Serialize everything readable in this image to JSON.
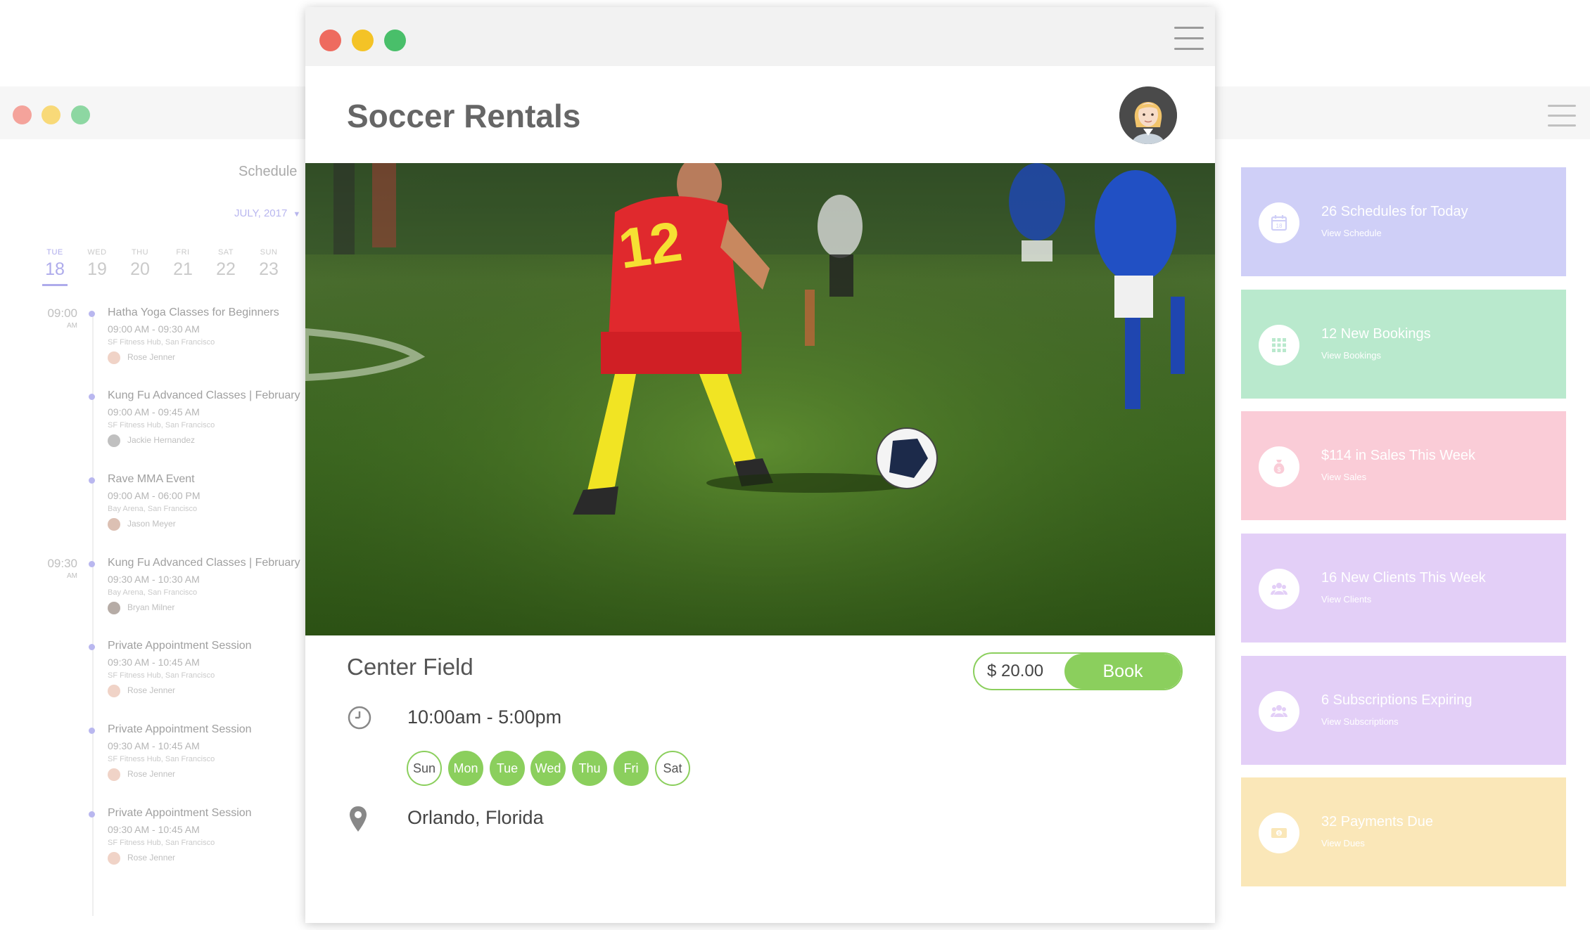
{
  "bg_window": {
    "schedule_title": "Schedule",
    "month": "JULY, 2017",
    "days": [
      {
        "name": "TUE",
        "num": "18"
      },
      {
        "name": "WED",
        "num": "19"
      },
      {
        "name": "THU",
        "num": "20"
      },
      {
        "name": "FRI",
        "num": "21"
      },
      {
        "name": "SAT",
        "num": "22"
      },
      {
        "name": "SUN",
        "num": "23"
      }
    ],
    "time_slots": [
      {
        "time": "09:00",
        "ampm": "AM"
      },
      {
        "time": "09:30",
        "ampm": "AM"
      }
    ],
    "events": [
      {
        "title": "Hatha Yoga Classes for Beginners",
        "time": "09:00 AM - 09:30 AM",
        "location": "SF Fitness Hub, San Francisco",
        "person": "Rose Jenner"
      },
      {
        "title": "Kung Fu Advanced Classes | February",
        "time": "09:00 AM - 09:45 AM",
        "location": "SF Fitness Hub, San Francisco",
        "person": "Jackie Hernandez"
      },
      {
        "title": "Rave MMA Event",
        "time": "09:00 AM - 06:00 PM",
        "location": "Bay Arena, San Francisco",
        "person": "Jason Meyer"
      },
      {
        "title": "Kung Fu Advanced Classes | February",
        "time": "09:30 AM - 10:30 AM",
        "location": "Bay Arena, San Francisco",
        "person": "Bryan Milner"
      },
      {
        "title": "Private Appointment Session",
        "time": "09:30 AM - 10:45 AM",
        "location": "SF Fitness Hub, San Francisco",
        "person": "Rose Jenner"
      },
      {
        "title": "Private Appointment Session",
        "time": "09:30 AM - 10:45 AM",
        "location": "SF Fitness Hub, San Francisco",
        "person": "Rose Jenner"
      },
      {
        "title": "Private Appointment Session",
        "time": "09:30 AM - 10:45 AM",
        "location": "SF Fitness Hub, San Francisco",
        "person": "Rose Jenner"
      }
    ],
    "cards": [
      {
        "title": "26 Schedules for Today",
        "sub": "View Schedule",
        "color": "#b3b2f3",
        "icon": "calendar-icon"
      },
      {
        "title": "12 New Bookings",
        "sub": "View Bookings",
        "color": "#8fddb0",
        "icon": "grid-icon"
      },
      {
        "title": "$114 in Sales This Week",
        "sub": "View Sales",
        "color": "#f7aec0",
        "icon": "money-bag-icon"
      },
      {
        "title": "16 New Clients This Week",
        "sub": "View Clients",
        "color": "#d2b3f3",
        "icon": "people-icon"
      },
      {
        "title": "6 Subscriptions Expiring",
        "sub": "View Subscriptions",
        "color": "#d2b3f3",
        "icon": "people-icon"
      },
      {
        "title": "32 Payments Due",
        "sub": "View Dues",
        "color": "#f7d98e",
        "icon": "cash-icon"
      }
    ]
  },
  "app": {
    "title": "Soccer Rentals",
    "field_name": "Center Field",
    "price": "$ 20.00",
    "book_label": "Book",
    "hours": "10:00am - 5:00pm",
    "days": [
      {
        "label": "Sun",
        "active": false
      },
      {
        "label": "Mon",
        "active": true
      },
      {
        "label": "Tue",
        "active": true
      },
      {
        "label": "Wed",
        "active": true
      },
      {
        "label": "Thu",
        "active": true
      },
      {
        "label": "Fri",
        "active": true
      },
      {
        "label": "Sat",
        "active": false
      }
    ],
    "location": "Orlando, Florida"
  },
  "colors": {
    "accent_green": "#8bcf5d",
    "accent_purple": "#7d79e0"
  }
}
